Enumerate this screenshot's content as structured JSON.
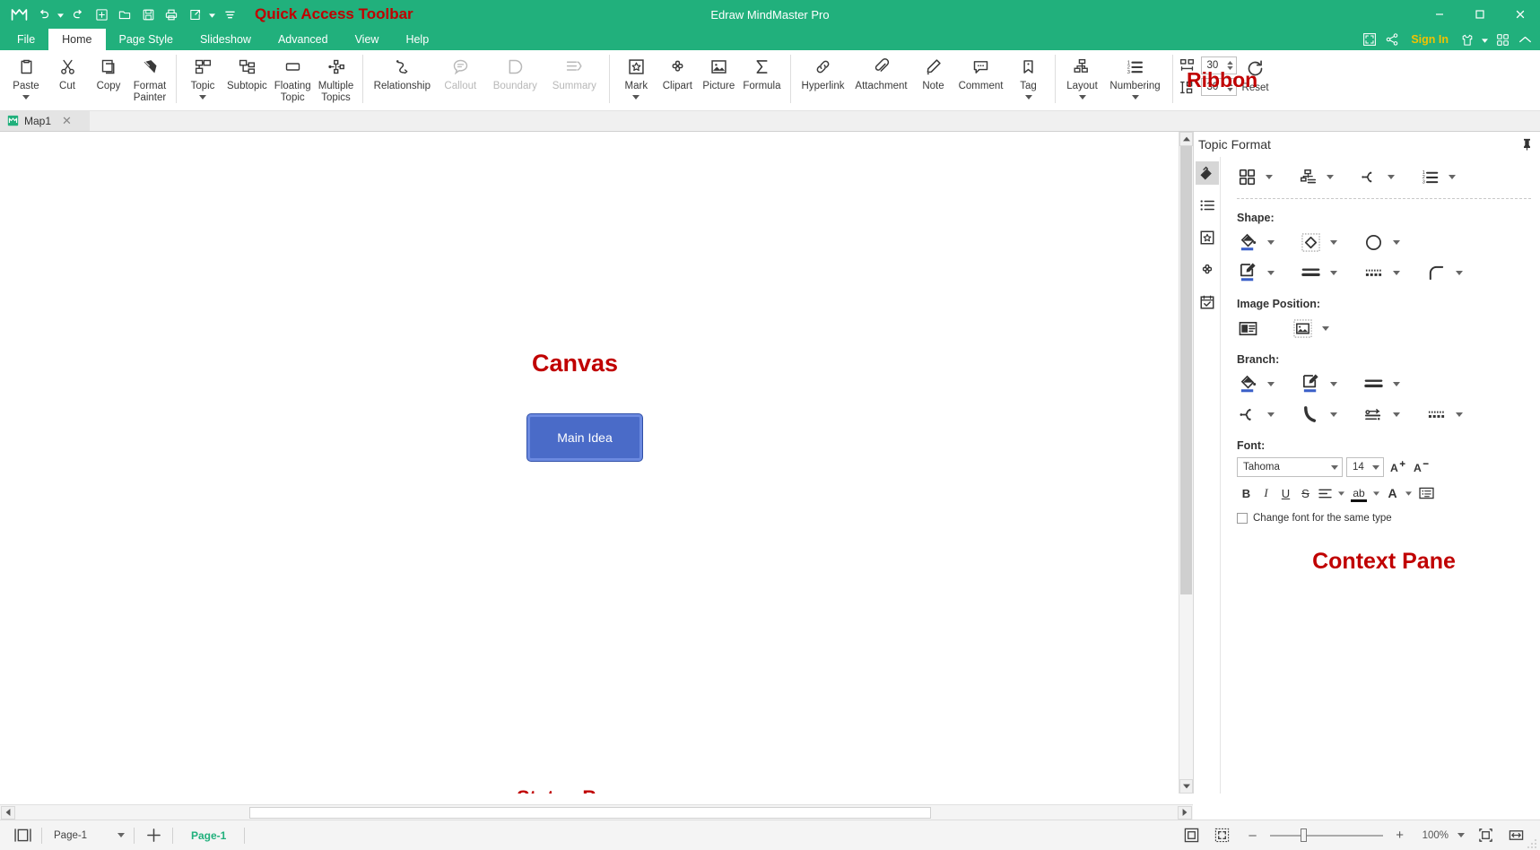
{
  "window": {
    "app_title": "Edraw MindMaster Pro",
    "minimize": "–",
    "maximize": "□",
    "close": "✕"
  },
  "quick_access": {
    "annotation": "Quick Access Toolbar",
    "items": [
      {
        "name": "app-logo-icon",
        "label": "MindMaster"
      },
      {
        "name": "undo-icon",
        "label": "Undo"
      },
      {
        "name": "redo-icon",
        "label": "Redo"
      },
      {
        "name": "new-icon",
        "label": "New"
      },
      {
        "name": "open-icon",
        "label": "Open"
      },
      {
        "name": "save-icon",
        "label": "Save"
      },
      {
        "name": "print-icon",
        "label": "Print"
      },
      {
        "name": "export-icon",
        "label": "Export"
      },
      {
        "name": "customize-icon",
        "label": "Customize Quick Access Toolbar"
      }
    ]
  },
  "menubar": {
    "tabs": [
      {
        "label": "File",
        "active": false
      },
      {
        "label": "Home",
        "active": true
      },
      {
        "label": "Page Style",
        "active": false
      },
      {
        "label": "Slideshow",
        "active": false
      },
      {
        "label": "Advanced",
        "active": false
      },
      {
        "label": "View",
        "active": false
      },
      {
        "label": "Help",
        "active": false
      }
    ],
    "sign_in": "Sign In",
    "right_icons": [
      {
        "name": "fullscreen-icon",
        "label": "Full Screen"
      },
      {
        "name": "share-icon",
        "label": "Share"
      },
      {
        "name": "theme-icon",
        "label": "Theme"
      },
      {
        "name": "apps-grid-icon",
        "label": "Apps"
      },
      {
        "name": "collapse-ribbon-icon",
        "label": "Collapse Ribbon"
      }
    ]
  },
  "ribbon": {
    "annotation": "Ribbon",
    "groups": [
      {
        "name": "clipboard",
        "buttons": [
          {
            "label": "Paste",
            "icon": "paste-icon",
            "caret": true,
            "disabled": false
          },
          {
            "label": "Cut",
            "icon": "cut-icon",
            "caret": false,
            "disabled": false
          },
          {
            "label": "Copy",
            "icon": "copy-icon",
            "caret": false,
            "disabled": false
          },
          {
            "label": "Format\nPainter",
            "icon": "format-painter-icon",
            "caret": false,
            "disabled": false
          }
        ]
      },
      {
        "name": "topics",
        "buttons": [
          {
            "label": "Topic",
            "icon": "topic-icon",
            "caret": true,
            "disabled": false
          },
          {
            "label": "Subtopic",
            "icon": "subtopic-icon",
            "caret": false,
            "disabled": false
          },
          {
            "label": "Floating\nTopic",
            "icon": "floating-topic-icon",
            "caret": false,
            "disabled": false
          },
          {
            "label": "Multiple\nTopics",
            "icon": "multiple-topics-icon",
            "caret": false,
            "disabled": false
          }
        ]
      },
      {
        "name": "structure",
        "buttons": [
          {
            "label": "Relationship",
            "icon": "relationship-icon",
            "caret": false,
            "disabled": false
          },
          {
            "label": "Callout",
            "icon": "callout-icon",
            "caret": false,
            "disabled": true
          },
          {
            "label": "Boundary",
            "icon": "boundary-icon",
            "caret": false,
            "disabled": true
          },
          {
            "label": "Summary",
            "icon": "summary-icon",
            "caret": false,
            "disabled": true
          }
        ]
      },
      {
        "name": "insert",
        "buttons": [
          {
            "label": "Mark",
            "icon": "mark-icon",
            "caret": true,
            "disabled": false
          },
          {
            "label": "Clipart",
            "icon": "clipart-icon",
            "caret": false,
            "disabled": false
          },
          {
            "label": "Picture",
            "icon": "picture-icon",
            "caret": false,
            "disabled": false
          },
          {
            "label": "Formula",
            "icon": "formula-icon",
            "caret": false,
            "disabled": false
          }
        ]
      },
      {
        "name": "annotate",
        "buttons": [
          {
            "label": "Hyperlink",
            "icon": "hyperlink-icon",
            "caret": false,
            "disabled": false
          },
          {
            "label": "Attachment",
            "icon": "attachment-icon",
            "caret": false,
            "disabled": false
          },
          {
            "label": "Note",
            "icon": "note-icon",
            "caret": false,
            "disabled": false
          },
          {
            "label": "Comment",
            "icon": "comment-icon",
            "caret": false,
            "disabled": false
          },
          {
            "label": "Tag",
            "icon": "tag-icon",
            "caret": true,
            "disabled": false
          }
        ]
      },
      {
        "name": "layout",
        "buttons": [
          {
            "label": "Layout",
            "icon": "layout-icon",
            "caret": true,
            "disabled": false
          },
          {
            "label": "Numbering",
            "icon": "numbering-icon",
            "caret": true,
            "disabled": false
          }
        ]
      }
    ],
    "spacing": {
      "horizontal": {
        "icon": "horizontal-spacing-icon",
        "value": "30"
      },
      "vertical": {
        "icon": "vertical-spacing-icon",
        "value": "30"
      }
    },
    "reset": {
      "label": "Reset",
      "icon": "reset-icon"
    }
  },
  "doc_tabs": [
    {
      "label": "Map1",
      "icon": "map-file-icon",
      "close": "✕"
    }
  ],
  "canvas": {
    "annotation": "Canvas",
    "status_annotation": "Status Bar",
    "nodes": [
      {
        "label": "Main Idea",
        "selected": true
      }
    ]
  },
  "right_panel": {
    "title": "Topic Format",
    "annotation": "Context Pane",
    "pin_icon": "pin-icon",
    "tabs": [
      {
        "name": "topic-format-tab",
        "icon": "paint-bucket-icon",
        "active": true
      },
      {
        "name": "outline-tab",
        "icon": "list-icon",
        "active": false
      },
      {
        "name": "mark-tab",
        "icon": "badge-icon",
        "active": false
      },
      {
        "name": "clipart-tab",
        "icon": "clover-icon",
        "active": false
      },
      {
        "name": "task-tab",
        "icon": "calendar-check-icon",
        "active": false
      }
    ],
    "top_row": [
      {
        "name": "topic-style-button",
        "icon": "grid-four-icon",
        "caret": true
      },
      {
        "name": "topic-layout-button",
        "icon": "hierarchy-icon",
        "caret": true
      },
      {
        "name": "branch-style-button",
        "icon": "branch-icon",
        "caret": true
      },
      {
        "name": "numbering-button",
        "icon": "numbering-icon",
        "caret": true
      }
    ],
    "shape": {
      "label": "Shape:",
      "row1": [
        {
          "name": "shape-fill-button",
          "icon": "paint-bucket-icon",
          "caret": true,
          "accent": "#3A5FC8"
        },
        {
          "name": "shape-type-button",
          "icon": "diamond-icon",
          "caret": true
        },
        {
          "name": "shape-shadow-button",
          "icon": "shadow-icon",
          "caret": true
        }
      ],
      "row2": [
        {
          "name": "shape-line-color-button",
          "icon": "pen-square-icon",
          "caret": true,
          "accent": "#3A5FC8"
        },
        {
          "name": "shape-line-weight-button",
          "icon": "line-weight-icon",
          "caret": true
        },
        {
          "name": "shape-line-style-button",
          "icon": "dashed-line-icon",
          "caret": true
        },
        {
          "name": "shape-corner-button",
          "icon": "rounded-corner-icon",
          "caret": true
        }
      ]
    },
    "image_position": {
      "label": "Image Position:",
      "buttons": [
        {
          "name": "image-left-button",
          "icon": "image-left-icon",
          "caret": false
        },
        {
          "name": "image-fill-button",
          "icon": "image-fill-icon",
          "caret": true
        }
      ]
    },
    "branch": {
      "label": "Branch:",
      "row1": [
        {
          "name": "branch-fill-button",
          "icon": "paint-bucket-icon",
          "caret": true,
          "accent": "#3A5FC8"
        },
        {
          "name": "branch-color-button",
          "icon": "pen-square-icon",
          "caret": true,
          "accent": "#3A5FC8"
        },
        {
          "name": "branch-weight-button",
          "icon": "line-weight-icon",
          "caret": true
        }
      ],
      "row2": [
        {
          "name": "branch-style-button",
          "icon": "branch-icon",
          "caret": true
        },
        {
          "name": "branch-curve-button",
          "icon": "curve-icon",
          "caret": true
        },
        {
          "name": "branch-arrow-button",
          "icon": "arrow-style-icon",
          "caret": true
        },
        {
          "name": "branch-dash-button",
          "icon": "dashed-line-icon",
          "caret": true
        }
      ]
    },
    "font": {
      "label": "Font:",
      "family": "Tahoma",
      "size": "14",
      "increase_label": "A",
      "decrease_label": "A",
      "buttons": [
        {
          "name": "bold-button",
          "label": "B"
        },
        {
          "name": "italic-button",
          "label": "I"
        },
        {
          "name": "underline-button",
          "label": "U"
        },
        {
          "name": "strikethrough-button",
          "label": "S"
        },
        {
          "name": "align-button",
          "icon": "align-icon",
          "caret": true
        },
        {
          "name": "highlight-button",
          "label": "ab",
          "caret": true
        },
        {
          "name": "font-color-button",
          "label": "A",
          "caret": true
        },
        {
          "name": "text-box-button",
          "icon": "text-box-icon"
        }
      ],
      "checkbox": {
        "label": "Change font for the same type",
        "checked": false
      }
    }
  },
  "status_bar": {
    "page_view_icon": "page-view-icon",
    "page_selector": "Page-1",
    "add_page_label": "+",
    "page_tab": "Page-1",
    "zoom_out": "–",
    "zoom_in": "+",
    "zoom_level": "100%",
    "fit_page_icon": "fit-page-icon",
    "fit_width_icon": "fit-width-icon",
    "zoom_actual_icon": "zoom-actual-icon",
    "full_screen_icon": "full-screen-icon"
  }
}
